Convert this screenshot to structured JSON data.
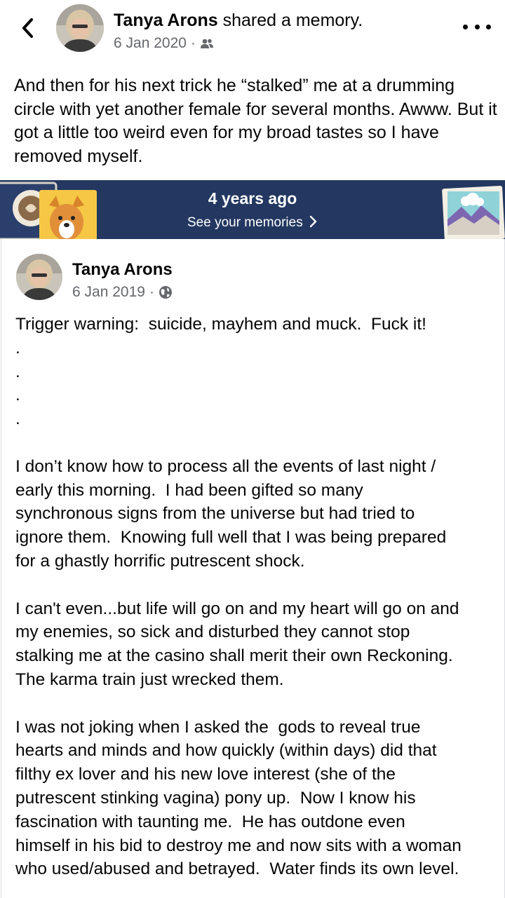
{
  "header": {
    "name": "Tanya Arons",
    "action": " shared a memory.",
    "date": "6 Jan 2020",
    "separator": "·",
    "audience_icon": "friends-icon"
  },
  "share_text": "And then for his next trick he “stalked” me at a drumming circle with yet another female for several months.  Awww. But it got a little too weird even for my broad tastes so I have removed myself.",
  "banner": {
    "title": "4 years ago",
    "link": "See your memories",
    "chevron": "›",
    "background": "#233760"
  },
  "post": {
    "author": "Tanya Arons",
    "date": "6 Jan 2019",
    "separator": "·",
    "audience_icon": "globe-icon",
    "lines": [
      "Trigger warning:  suicide, mayhem and muck.  Fuck it!",
      ".",
      ".",
      ".",
      ".",
      "",
      "I don’t know how to process all the events of last night /",
      "early this morning.  I had been gifted so many",
      "synchronous signs from the universe but had tried to",
      "ignore them.  Knowing full well that I was being prepared",
      "for a ghastly horrific putrescent shock.",
      "",
      "I can't even...but life will go on and my heart will go on and",
      "my enemies, so sick and disturbed they cannot stop",
      "stalking me at the casino shall merit their own Reckoning.",
      "The karma train just wrecked them.",
      "",
      "I was not joking when I asked the  gods to reveal true",
      "hearts and minds and how quickly (within days) did that",
      "filthy ex lover and his new love interest (she of the",
      "putrescent stinking vagina) pony up.  Now I know his",
      "fascination with taunting me.  He has outdone even",
      "himself in his bid to destroy me and now sits with a woman",
      "who used/abused and betrayed.  Water finds its own level."
    ]
  },
  "colors": {
    "text": "#050505",
    "meta": "#65676b",
    "banner": "#233760"
  }
}
